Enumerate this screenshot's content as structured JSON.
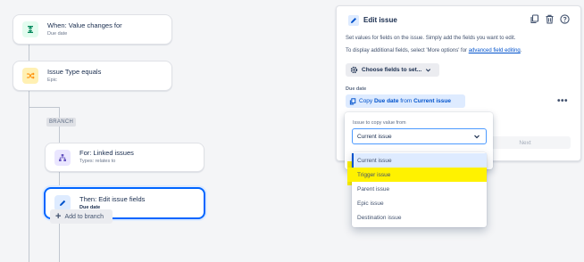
{
  "flow": {
    "trigger": {
      "title": "When: Value changes for",
      "subtitle": "Due date",
      "icon": "trigger-icon"
    },
    "condition": {
      "title": "Issue Type equals",
      "subtitle": "Epic",
      "icon": "shuffle-icon"
    },
    "branch_tag": "BRANCH",
    "branch": {
      "title": "For: Linked issues",
      "subtitle": "Types: relates to",
      "icon": "hierarchy-icon"
    },
    "action": {
      "title": "Then: Edit issue fields",
      "subtitle": "Due date",
      "icon": "pencil-icon"
    },
    "add_branch": "Add to branch"
  },
  "panel": {
    "title": "Edit issue",
    "desc1": "Set values for fields on the issue. Simply add the fields you want to edit.",
    "desc2_prefix": "To display additional fields, select 'More options' for ",
    "desc2_link": "advanced field editing",
    "desc2_suffix": ".",
    "choose_button": "Choose fields to set...",
    "field_label": "Due date",
    "copy_pill": {
      "prefix": "Copy ",
      "field": "Due date",
      "middle": " from ",
      "source": "Current issue"
    },
    "next_button": "Next"
  },
  "popover": {
    "label": "Issue to copy value from",
    "selected": "Current issue",
    "options": [
      "Current issue",
      "Trigger issue",
      "Parent issue",
      "Epic issue",
      "Destination issue"
    ],
    "active_index": 0,
    "highlight_index": 1,
    "highlight_color": "#fff200"
  },
  "colors": {
    "accent": "#0052cc",
    "selected_border": "#0065ff",
    "trigger_icon_bg": "#e3fcef",
    "condition_icon_bg": "#fff0b3",
    "branch_icon_bg": "#eae6ff",
    "action_icon_bg": "#deebff"
  }
}
